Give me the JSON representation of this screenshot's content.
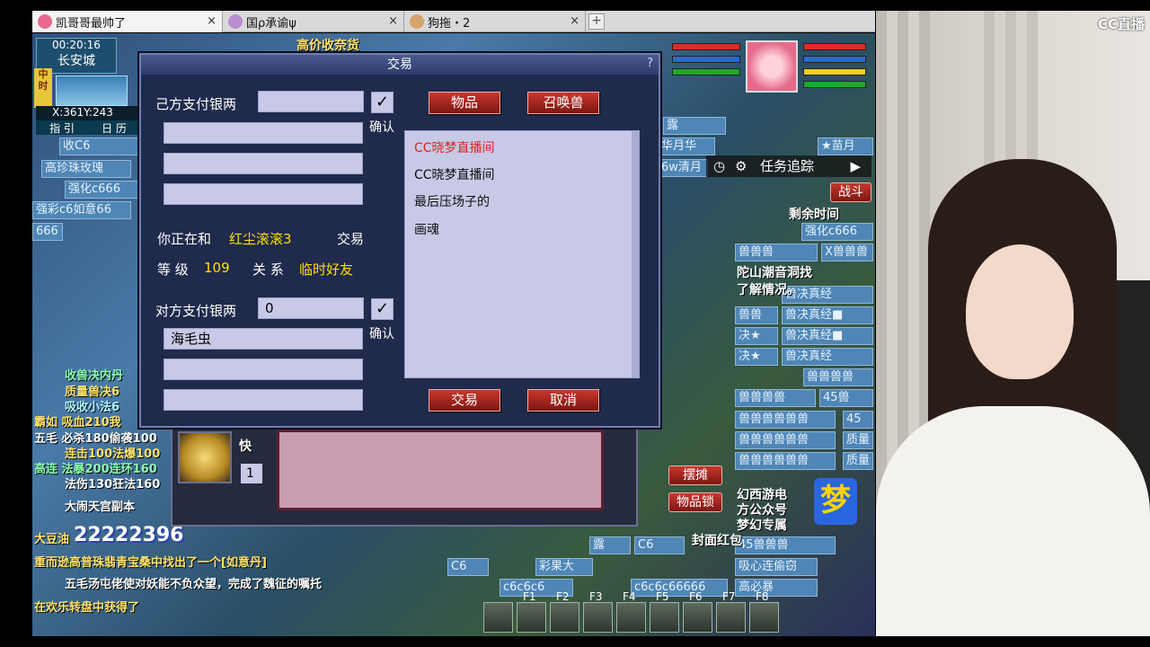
{
  "tabs": [
    {
      "title": "凯哥哥最帅了",
      "close": "×"
    },
    {
      "title": "国ρ承谕ψ",
      "close": "×"
    },
    {
      "title": "狗拖・2",
      "close": "×"
    }
  ],
  "tab_add": "+",
  "game": {
    "time": "00:20:16",
    "location": "长安城",
    "coords": "X:361Y:243",
    "time_badge": "中时",
    "ticker_top": "高价收奈货",
    "menu_labels": [
      "指 引",
      "日 历"
    ],
    "left_tiles": [
      "收C6",
      "高珍珠玫瑰",
      "强化c666",
      "强彩c6如意66",
      "666"
    ],
    "chat_lines": [
      "收兽决内丹",
      "质量兽决6",
      "吸收小法6",
      "霸如 吸血210我",
      "五毛 必杀180偷袭100",
      "连击100法爆100",
      "高连 法暴200连环160",
      "法伤130狂法160",
      "大闹天宫副本"
    ],
    "big_number_prefix": "大豆油",
    "big_number": "22222396",
    "system_msgs": [
      "重而逊高普珠翡青宝桑中找出了一个[如意丹]",
      "五毛汤屯佬使对妖能不负众望，完成了魏征的嘱托",
      "在欢乐转盘中获得了"
    ],
    "task_tracker": "任务追踪",
    "battle_label": "战斗",
    "remaining_time": "剩余时间",
    "quest_text": [
      "陀山潮音洞找",
      "了解情况。"
    ],
    "right_tiles": [
      "露",
      "华月华",
      "★苗月",
      "6w清月",
      "强化c666",
      "X兽兽兽",
      "兽兽兽",
      "兽决真经",
      "兽兽",
      "兽决真经■",
      "决★",
      "兽决真经■",
      "决★",
      "兽决真经",
      "兽兽兽兽",
      "兽兽兽兽",
      "45兽",
      "兽兽兽兽兽兽",
      "45",
      "兽兽兽兽兽兽",
      "质量",
      "兽兽兽兽兽兽",
      "质量",
      "45兽兽兽",
      "吸心连偷窃",
      "高必暴"
    ],
    "promo_lines": [
      "幻西游电",
      "方公众号",
      "梦幻专属",
      "封面红包"
    ],
    "stall_btn": "摆摊",
    "lock_btn": "物品锁",
    "hotkeys": [
      "F1",
      "F2",
      "F3",
      "F4",
      "F5",
      "F6",
      "F7",
      "F8"
    ],
    "quick_label": "快",
    "qty_value": "1",
    "bottom_tiles": [
      "C6",
      "露",
      "C6",
      "彩果大",
      "c6c6c6",
      "c6c6c66666"
    ]
  },
  "trade": {
    "title": "交易",
    "help": "?",
    "my_silver_label": "己方支付银两",
    "my_silver_value": "",
    "confirm_label": "确认",
    "tab_items": "物品",
    "tab_pets": "召唤兽",
    "trading_with_label": "你正在和",
    "partner_name": "红尘滚滚3",
    "trading_suffix": "交易",
    "level_label": "等 级",
    "level_value": "109",
    "relation_label": "关 系",
    "relation_value": "临时好友",
    "their_silver_label": "对方支付银两",
    "their_silver_value": "0",
    "their_item_1": "海毛虫",
    "list_items": [
      "CC晓梦直播间",
      "CC晓梦直播间",
      "最后压场子的",
      "画魂"
    ],
    "trade_btn": "交易",
    "cancel_btn": "取消"
  },
  "cam": {
    "logo": "CC直播"
  }
}
